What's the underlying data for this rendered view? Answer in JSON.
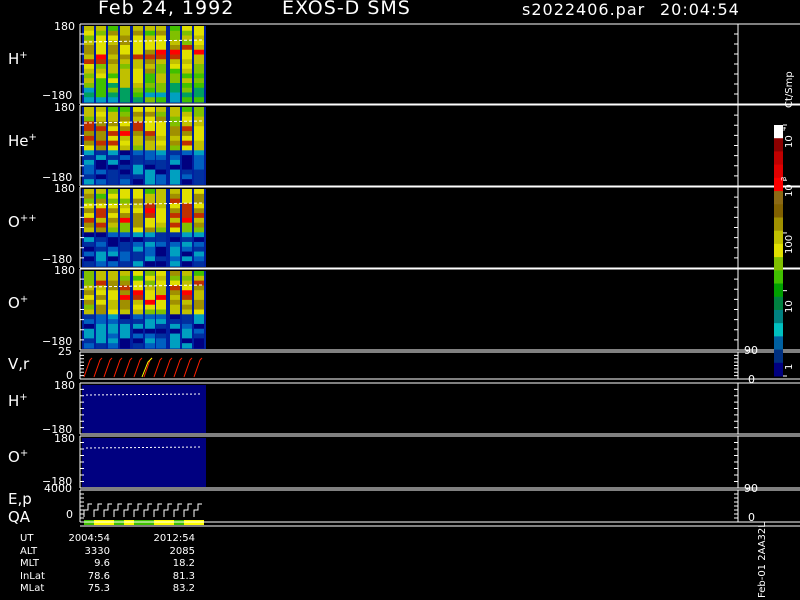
{
  "header": {
    "date": "Feb 24, 1992",
    "instrument": "EXOS-D SMS",
    "file": "s2022406.par",
    "time": "20:04:54"
  },
  "panels": [
    {
      "id": "h-plus",
      "label_base": "H",
      "label_sup": "+",
      "ytop": "180",
      "ybot": "−180"
    },
    {
      "id": "he-plus",
      "label_base": "He",
      "label_sup": "+",
      "ytop": "180",
      "ybot": "−180"
    },
    {
      "id": "o-plus-plus",
      "label_base": "O",
      "label_sup": "++",
      "ytop": "180",
      "ybot": "−180"
    },
    {
      "id": "o-plus",
      "label_base": "O",
      "label_sup": "+",
      "ytop": "180",
      "ybot": "−180"
    }
  ],
  "velocity_panel": {
    "label": "V,r",
    "ytop": "25",
    "ybot": "0",
    "rtop": "90",
    "rbot": "0"
  },
  "lower_panels": [
    {
      "id": "h-plus-2",
      "label_base": "H",
      "label_sup": "+",
      "ytop": "180",
      "ybot": "−180"
    },
    {
      "id": "o-plus-2",
      "label_base": "O",
      "label_sup": "+",
      "ytop": "180",
      "ybot": "−180"
    }
  ],
  "energy_panel": {
    "label1": "E,p",
    "label2": "QA",
    "ytop": "4000",
    "ybot": "0",
    "rtop": "90",
    "rbot": "0"
  },
  "colorbar": {
    "unit": "Ct/Smp",
    "labels": [
      "10",
      "4",
      "10",
      "3",
      "100",
      "10",
      "1"
    ],
    "colors": [
      "#ffffff",
      "#8b0000",
      "#c00000",
      "#e00000",
      "#ff0000",
      "#8b6914",
      "#806000",
      "#a09000",
      "#c0c000",
      "#e0e000",
      "#80c000",
      "#40c000",
      "#00a000",
      "#008040",
      "#008080",
      "#00c0c0",
      "#0060a0",
      "#003080",
      "#000080"
    ]
  },
  "footer": {
    "headers": [
      "UT",
      "ALT",
      "MLT",
      "InLat",
      "MLat"
    ],
    "col1": [
      "2004:54",
      "3330",
      "9.6",
      "78.6",
      "75.3"
    ],
    "col2": [
      "2012:54",
      "2085",
      "18.2",
      "81.3",
      "83.2"
    ],
    "stamp": "Feb-01 2AA32L"
  }
}
